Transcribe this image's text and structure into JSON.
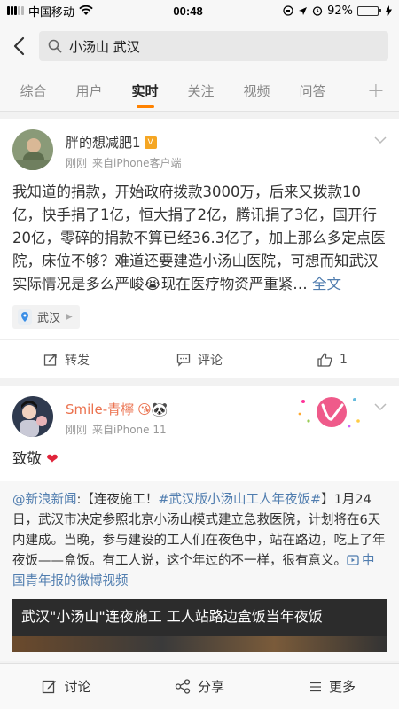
{
  "status_bar": {
    "carrier": "中国移动",
    "time": "00:48",
    "battery": "92%",
    "battery_level": 0.92
  },
  "search": {
    "query": "小汤山 武汉"
  },
  "tabs": [
    {
      "label": "综合"
    },
    {
      "label": "用户"
    },
    {
      "label": "实时"
    },
    {
      "label": "关注"
    },
    {
      "label": "视频"
    },
    {
      "label": "问答"
    }
  ],
  "tabs_add": "+",
  "post1": {
    "username": "胖的想减肥1",
    "time": "刚刚",
    "source": "来自iPhone客户端",
    "text": "我知道的捐款，开始政府拨款3000万，后来又拨款10亿，快手捐了1亿，恒大捐了2亿，腾讯捐了3亿，国开行20亿，零碎的捐款不算已经36.3亿了，加上那么多定点医院，床位不够？难道还要建造小汤山医院，可想而知武汉实际情况是多么严峻😭现在医疗物资严重紧… ",
    "full_link": "全文",
    "location": "武汉",
    "actions": {
      "repost": "转发",
      "comment": "评论",
      "like": "1"
    }
  },
  "post2": {
    "username": "Smile-青檸",
    "name_emoji": "😘🐼",
    "time": "刚刚",
    "source": "来自iPhone 11",
    "text": "致敬",
    "repost": {
      "mention": "@新浪新闻",
      "body_1": ":【连夜施工！",
      "hashtag": "#武汉版小汤山工人年夜饭#",
      "body_2": "】1月24日，武汉市决定参照北京小汤山模式建立急救医院，计划将在6天内建成。当晚，参与建设的工人们在夜色中，站在路边，吃上了年夜饭——盒饭。有工人说，这个年过的不一样，很有意义。",
      "video_link": "中国青年报的微博视频",
      "video_title": "武汉\"小汤山\"连夜施工 工人站路边盒饭当年夜饭"
    }
  },
  "bottom_bar": {
    "discuss": "讨论",
    "share": "分享",
    "more": "更多"
  },
  "colors": {
    "accent": "#ff8200",
    "link": "#507daf",
    "heart": "#e0243a"
  }
}
